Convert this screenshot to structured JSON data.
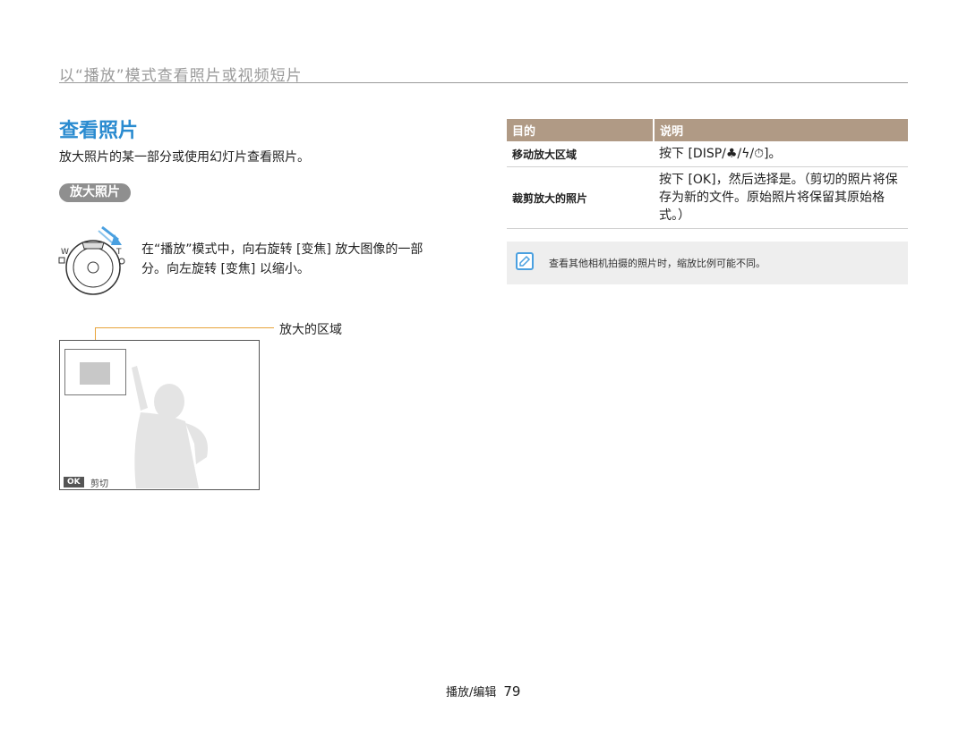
{
  "header": {
    "section": "以“播放”模式查看照片或视频短片"
  },
  "page": {
    "title": "查看照片",
    "intro": "放大照片的某一部分或使用幻灯片查看照片。",
    "subhead": "放大照片",
    "instruction_line1": "在“播放”模式中，向右旋转 [变焦] 放大图像的一部",
    "instruction_line2": "分。向左旋转 [变焦] 以缩小。",
    "lever": {
      "w": "W",
      "t": "T"
    },
    "callout": "放大的区域",
    "screen": {
      "ok": "OK",
      "ok_label": "剪切"
    }
  },
  "table": {
    "col_purpose": "目的",
    "col_desc": "说明",
    "rows": [
      {
        "purpose": "移动放大区域",
        "desc": "按下 [DISP/♣/ϟ/⏱]。"
      },
      {
        "purpose": "裁剪放大的照片",
        "desc": "按下 [OK]，然后选择是。（剪切的照片将保存为新的文件。原始照片将保留其原始格式。）"
      }
    ]
  },
  "note": {
    "text": "查看其他相机拍摄的照片时，缩放比例可能不同。"
  },
  "footer": {
    "section": "播放/编辑",
    "page_number": "79"
  },
  "colors": {
    "title_blue": "#2a8bd0",
    "table_header": "#b09a85",
    "callout_orange": "#e8a33a"
  }
}
